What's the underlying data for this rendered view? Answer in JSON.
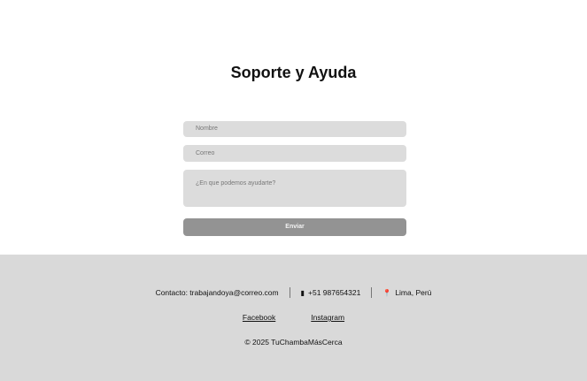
{
  "page": {
    "title": "Soporte y Ayuda"
  },
  "form": {
    "name_placeholder": "Nombre",
    "email_placeholder": "Correo",
    "message_placeholder": "¿En que podemos ayudarte?",
    "submit_label": "Enviar"
  },
  "footer": {
    "contact_label": "Contacto: trabajandoya@correo.com",
    "phone": "+51 987654321",
    "location": "Lima, Perú",
    "links": [
      "Facebook",
      "Instagram"
    ],
    "copyright": "© 2025 TuChambaMásCerca"
  },
  "icons": {
    "phone": "phone-icon",
    "location": "pin-icon"
  }
}
